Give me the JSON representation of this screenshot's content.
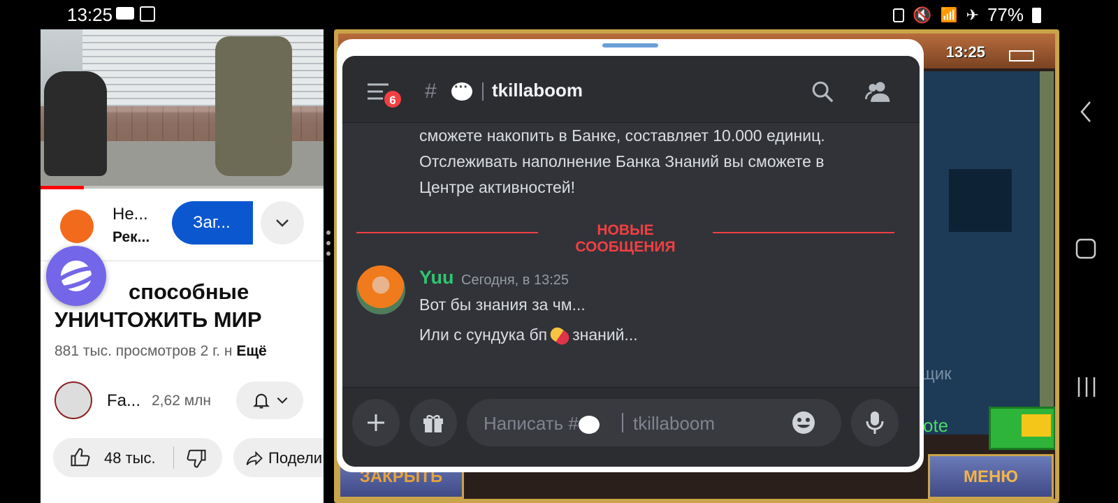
{
  "status_bar": {
    "time_left": "13:25",
    "battery": "77%"
  },
  "youtube": {
    "channel_name": "Не...",
    "channel_sub": "Рек...",
    "load_button": "Заг...",
    "title_line1": "способные",
    "title_line2": "УНИЧТОЖИТЬ МИР",
    "views": "881 тыс. просмотров  2 г. н",
    "more": "Ещё",
    "author_name": "Fa...",
    "author_subs": "2,62 млн",
    "likes": "48 тыс.",
    "share": "Подели"
  },
  "game": {
    "clock": "13:25",
    "map_text": "щик",
    "map_text2": "kote",
    "close_button": "ЗАКРЫТЬ",
    "menu_button": "МЕНЮ"
  },
  "discord": {
    "badge_count": "6",
    "channel_name": "tkillaboom",
    "prev_message_lines": [
      "сможете накопить в Банке, составляет 10.000 единиц.",
      "Отслеживать наполнение Банка Знаний вы сможете в",
      "Центре активностей!"
    ],
    "new_messages_label": "НОВЫЕ СООБЩЕНИЯ",
    "message": {
      "username": "Yuu",
      "timestamp": "Сегодня, в 13:25",
      "line1": "Вот бы знания за чм...",
      "line2_before": "Или с сундука бп",
      "line2_after": "знаний..."
    },
    "input_placeholder": "Написать #",
    "input_channel": "tkillaboom"
  },
  "colors": {
    "discord_bg": "#313338",
    "discord_header": "#2b2d31",
    "new_messages": "#f23f43",
    "username": "#2dc770",
    "youtube_blue": "#0b57d0"
  }
}
